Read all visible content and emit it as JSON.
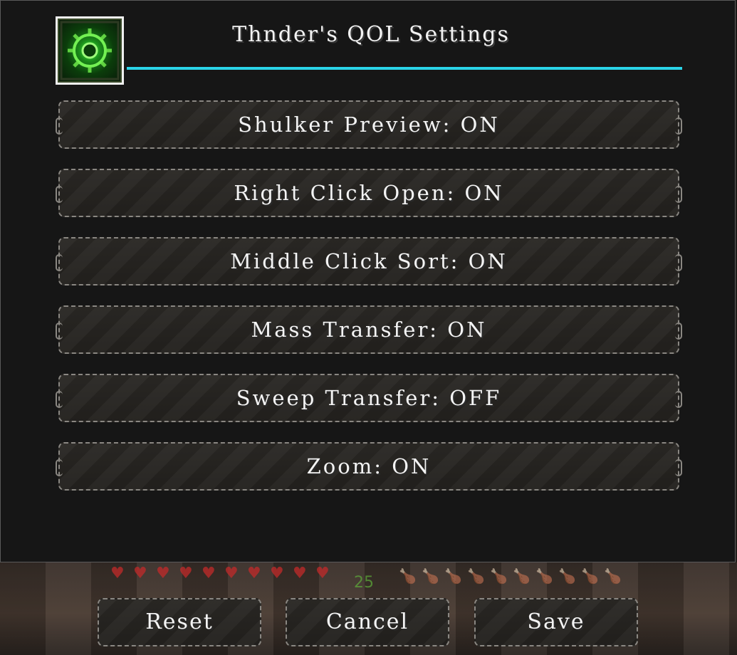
{
  "window": {
    "title": "Thnder's QOL Settings",
    "accent_color": "#2ad4e8",
    "logo_icon": "green-gear-emblem-icon"
  },
  "options": [
    {
      "label": "Shulker Preview: ON"
    },
    {
      "label": "Right Click Open: ON"
    },
    {
      "label": "Middle Click Sort: ON"
    },
    {
      "label": "Mass Transfer: ON"
    },
    {
      "label": "Sweep Transfer: OFF"
    },
    {
      "label": "Zoom: ON"
    }
  ],
  "footer": {
    "reset_label": "Reset",
    "cancel_label": "Cancel",
    "save_label": "Save"
  },
  "hud": {
    "xp_level": "25",
    "heart_icon": "heart-icon",
    "hunger_icon": "drumstick-icon"
  }
}
